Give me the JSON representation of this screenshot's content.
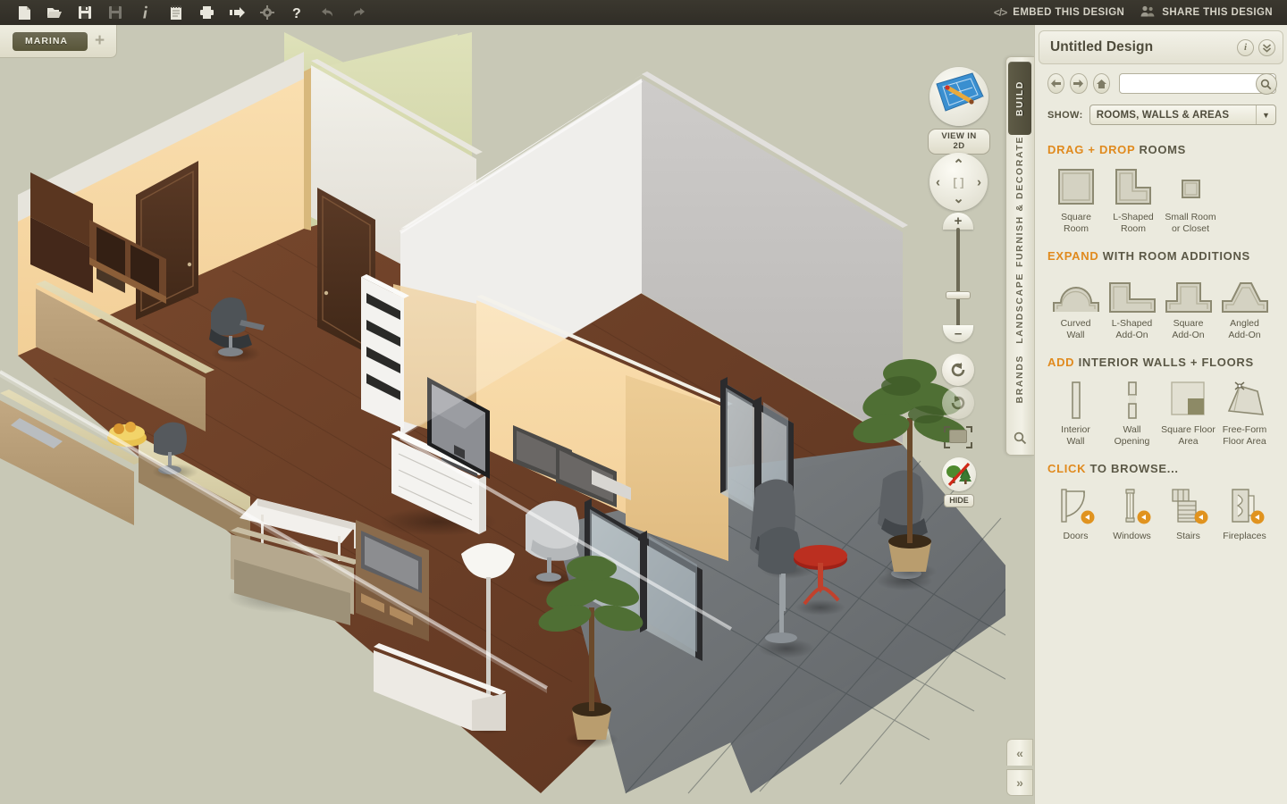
{
  "toolbar": {
    "icons": [
      {
        "name": "new-document-icon",
        "label": "New"
      },
      {
        "name": "open-folder-icon",
        "label": "Open"
      },
      {
        "name": "save-icon",
        "label": "Save"
      },
      {
        "name": "save-as-icon",
        "label": "Save As"
      },
      {
        "name": "info-icon",
        "label": "Info"
      },
      {
        "name": "notes-icon",
        "label": "Notes"
      },
      {
        "name": "print-icon",
        "label": "Print"
      },
      {
        "name": "export-icon",
        "label": "Export"
      },
      {
        "name": "settings-gear-icon",
        "label": "Settings"
      },
      {
        "name": "help-icon",
        "label": "Help"
      },
      {
        "name": "undo-icon",
        "label": "Undo"
      },
      {
        "name": "redo-icon",
        "label": "Redo"
      }
    ],
    "embed_label": "EMBED THIS DESIGN",
    "embed_icon_text": "</>",
    "share_label": "SHARE THIS DESIGN"
  },
  "tabbar": {
    "active_tab": "MARINA",
    "add_label": "+"
  },
  "viewcontrols": {
    "view2d_label": "VIEW IN 2D",
    "pan_up": "⌃",
    "pan_down": "⌄",
    "pan_left": "‹",
    "pan_right": "›",
    "pan_center": "[ ]",
    "zoom_in": "+",
    "zoom_out": "–",
    "hide_label": "HIDE"
  },
  "vtabs": {
    "items": [
      {
        "label": "BUILD",
        "active": true
      },
      {
        "label": "FURNISH & DECORATE",
        "active": false
      },
      {
        "label": "LANDSCAPE",
        "active": false
      },
      {
        "label": "BRANDS",
        "active": false
      }
    ]
  },
  "panel": {
    "title": "Untitled Design",
    "info_label": "i",
    "collapse_label": "»",
    "search_value": "",
    "search_placeholder": "",
    "show_label": "SHOW:",
    "show_value": "ROOMS, WALLS & AREAS",
    "sections": [
      {
        "id": "drag-drop-rooms",
        "highlight": "DRAG + DROP",
        "rest": "ROOMS",
        "items": [
          {
            "name": "square-room",
            "label": "Square\nRoom",
            "label_line1": "Square",
            "label_line2": "Room"
          },
          {
            "name": "l-shaped-room",
            "label_line1": "L-Shaped",
            "label_line2": "Room"
          },
          {
            "name": "small-room-or-closet",
            "label_line1": "Small Room",
            "label_line2": "or Closet"
          }
        ]
      },
      {
        "id": "room-additions",
        "highlight": "EXPAND",
        "rest": "WITH ROOM ADDITIONS",
        "items": [
          {
            "name": "curved-wall",
            "label_line1": "Curved",
            "label_line2": "Wall"
          },
          {
            "name": "l-shaped-add-on",
            "label_line1": "L-Shaped",
            "label_line2": "Add-On"
          },
          {
            "name": "square-add-on",
            "label_line1": "Square",
            "label_line2": "Add-On"
          },
          {
            "name": "angled-add-on",
            "label_line1": "Angled",
            "label_line2": "Add-On"
          }
        ]
      },
      {
        "id": "interior-walls-floors",
        "highlight": "ADD",
        "rest": "INTERIOR WALLS + FLOORS",
        "items": [
          {
            "name": "interior-wall",
            "label_line1": "Interior",
            "label_line2": "Wall"
          },
          {
            "name": "wall-opening",
            "label_line1": "Wall",
            "label_line2": "Opening"
          },
          {
            "name": "square-floor-area",
            "label_line1": "Square Floor",
            "label_line2": "Area"
          },
          {
            "name": "free-form-floor-area",
            "label_line1": "Free-Form",
            "label_line2": "Floor Area"
          }
        ]
      },
      {
        "id": "click-to-browse",
        "highlight": "CLICK",
        "rest": "TO BROWSE...",
        "items": [
          {
            "name": "doors",
            "label_line1": "Doors",
            "label_line2": ""
          },
          {
            "name": "windows",
            "label_line1": "Windows",
            "label_line2": ""
          },
          {
            "name": "stairs",
            "label_line1": "Stairs",
            "label_line2": ""
          },
          {
            "name": "fireplaces",
            "label_line1": "Fireplaces",
            "label_line2": ""
          }
        ]
      }
    ]
  },
  "collapse": {
    "up": "«",
    "down": "»"
  },
  "colors": {
    "accent_orange": "#e08a1e",
    "panel_bg": "#ebeade",
    "canvas_bg": "#c8c8b6",
    "toolbar_bg": "#34312a",
    "tab_active": "#5f5c47",
    "wall_cream": "#f6d9a8",
    "wall_green": "#d9dcb4",
    "floor_wood": "#6b3e28",
    "terrace_gray": "#6e7275"
  }
}
